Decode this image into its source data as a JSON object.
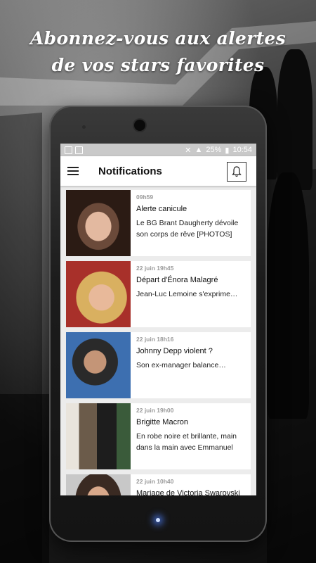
{
  "headline": {
    "line1": "Abonnez-vous aux alertes",
    "line2": "de vos stars favorites"
  },
  "status_bar": {
    "battery": "25%",
    "time": "10:54"
  },
  "app_bar": {
    "title": "Notifications"
  },
  "notifications": [
    {
      "time": "09h59",
      "title": "Alerte canicule",
      "desc": "Le BG Brant Daugherty dévoile son corps de rêve [PHOTOS]"
    },
    {
      "time": "22 juin 19h45",
      "title": "Départ d'Énora Malagré",
      "desc": "Jean-Luc Lemoine s'exprime…"
    },
    {
      "time": "22 juin 18h16",
      "title": "Johnny Depp violent ?",
      "desc": "Son ex-manager balance…"
    },
    {
      "time": "22 juin 19h00",
      "title": "Brigitte Macron",
      "desc": "En robe noire et brillante, main dans la main avec Emmanuel"
    },
    {
      "time": "22 juin 10h40",
      "title": "Mariage de Victoria Swarovski",
      "desc": ""
    }
  ],
  "colors": {
    "screen_bg": "#ececec",
    "status_bar": "#c9c9c9",
    "home_glow": "#5082ff"
  }
}
